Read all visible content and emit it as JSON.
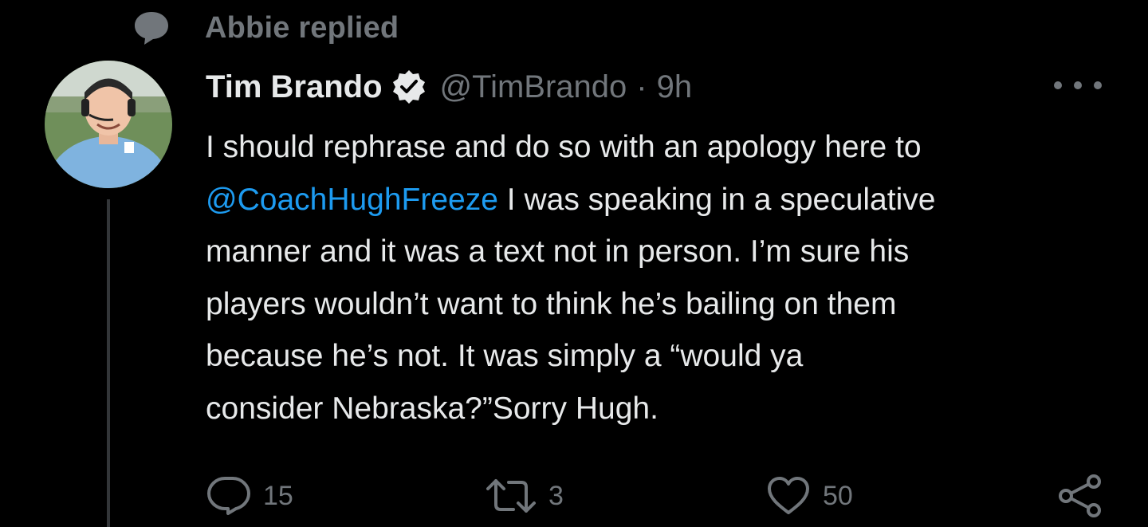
{
  "social_context": {
    "icon": "speech-bubble-icon",
    "label": "Abbie replied"
  },
  "author": {
    "display_name": "Tim Brando",
    "verified": true,
    "handle": "@TimBrando",
    "separator": "·",
    "timestamp": "9h"
  },
  "tweet": {
    "lines": [
      {
        "segments": [
          {
            "text": "I should rephrase and do so with an apology here to",
            "type": "text"
          }
        ]
      },
      {
        "segments": [
          {
            "text": "@CoachHughFreeze",
            "type": "mention"
          },
          {
            "text": " I was speaking in a speculative",
            "type": "text"
          }
        ]
      },
      {
        "segments": [
          {
            "text": "manner and it was a text not in person. I’m sure his",
            "type": "text"
          }
        ]
      },
      {
        "segments": [
          {
            "text": "players wouldn’t want to think he’s bailing on them",
            "type": "text"
          }
        ]
      },
      {
        "segments": [
          {
            "text": "because he’s not. It was simply a “would ya",
            "type": "text"
          }
        ]
      },
      {
        "segments": [
          {
            "text": "consider Nebraska?”Sorry Hugh.",
            "type": "text"
          }
        ]
      }
    ]
  },
  "actions": {
    "reply": {
      "icon": "reply-icon",
      "count": "15"
    },
    "retweet": {
      "icon": "retweet-icon",
      "count": "3"
    },
    "like": {
      "icon": "heart-icon",
      "count": "50"
    },
    "share": {
      "icon": "share-icon"
    }
  },
  "colors": {
    "background": "#000000",
    "primary_text": "#e7e9ea",
    "secondary_text": "#71767b",
    "accent": "#1d9bf0",
    "thread_line": "#333639"
  }
}
